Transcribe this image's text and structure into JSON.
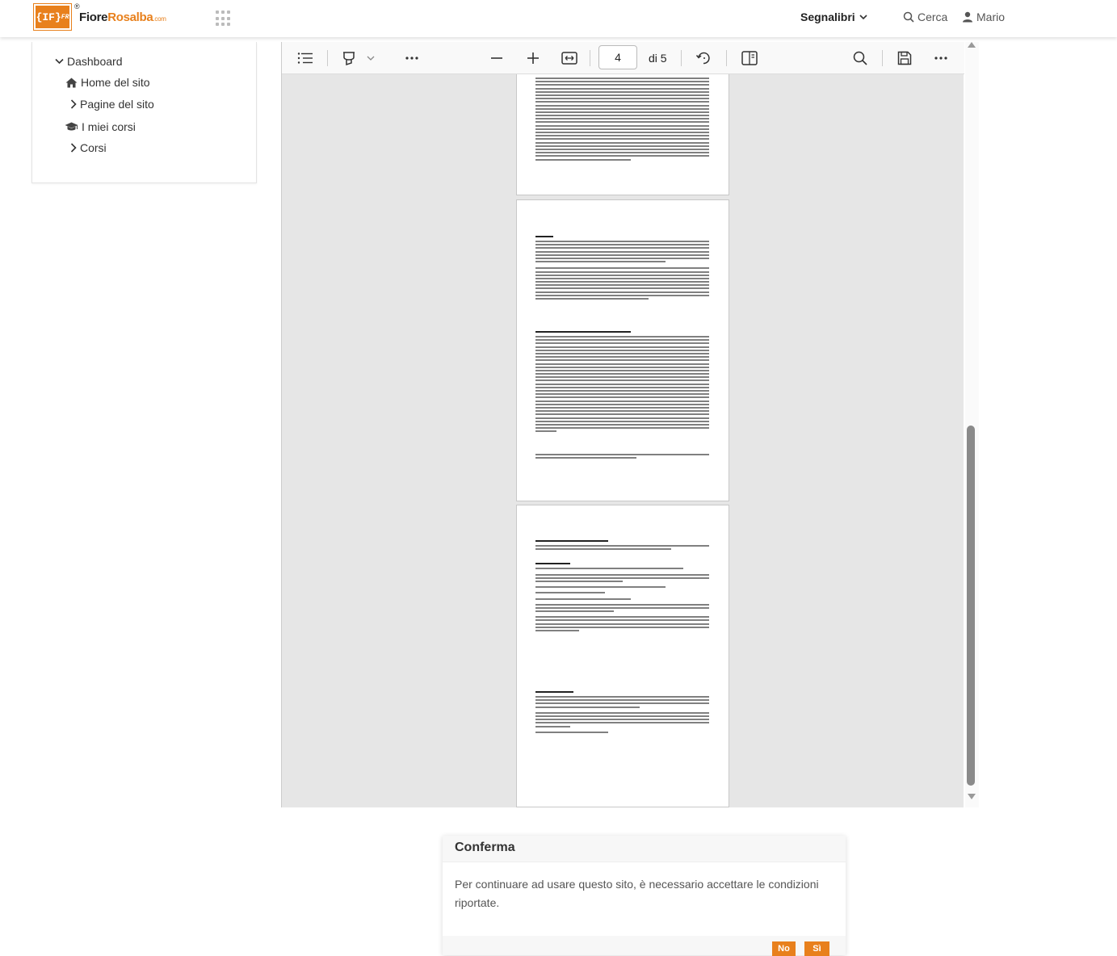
{
  "header": {
    "logo_mark": "{IF}",
    "logo_mark_sup": "FR",
    "logo_reg": "®",
    "logo_name_1": "Fiore",
    "logo_name_2": "Rosalba",
    "logo_com": ".com",
    "bookmarks_label": "Segnalibri",
    "search_label": "Cerca",
    "user_name": "Mario"
  },
  "sidebar": {
    "items": [
      {
        "label": "Dashboard",
        "icon": "chevron-down-icon"
      },
      {
        "label": "Home del sito",
        "icon": "home-icon"
      },
      {
        "label": "Pagine del sito",
        "icon": "chevron-right-icon"
      },
      {
        "label": "I miei corsi",
        "icon": "graduation-cap-icon"
      },
      {
        "label": "Corsi",
        "icon": "chevron-right-icon"
      }
    ]
  },
  "viewer": {
    "current_page": "4",
    "page_total": "di 5"
  },
  "dialog": {
    "title": "Conferma",
    "message": "Per continuare ad usare questo sito, è necessario accettare le condizioni riportate.",
    "no_label": "No",
    "yes_label": "Sì"
  },
  "colors": {
    "accent": "#e8801c"
  }
}
